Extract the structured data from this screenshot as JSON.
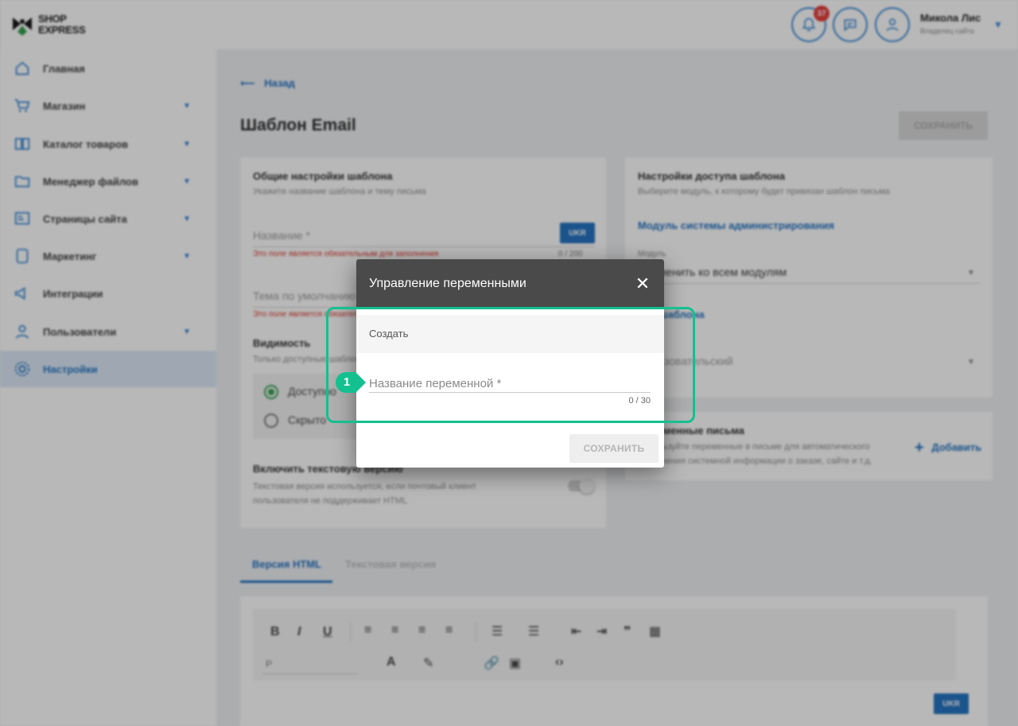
{
  "header": {
    "logo_line1": "SHOP",
    "logo_line2": "EXPRESS",
    "notification_count": "37",
    "user_name": "Микола Лис",
    "user_role": "Владелец сайта"
  },
  "sidebar": {
    "items": [
      {
        "label": "Главная",
        "icon": "home-icon"
      },
      {
        "label": "Магазин",
        "icon": "cart-icon"
      },
      {
        "label": "Каталог товаров",
        "icon": "book-icon"
      },
      {
        "label": "Менеджер файлов",
        "icon": "folder-icon"
      },
      {
        "label": "Страницы сайта",
        "icon": "page-icon"
      },
      {
        "label": "Маркетинг",
        "icon": "marketing-icon"
      },
      {
        "label": "Интеграции",
        "icon": "megaphone-icon"
      },
      {
        "label": "Пользователи",
        "icon": "user-icon"
      },
      {
        "label": "Настройки",
        "icon": "gear-icon"
      }
    ]
  },
  "page": {
    "back_label": "Назад",
    "title": "Шаблон Email",
    "save_label": "СОХРАНИТЬ"
  },
  "general_card": {
    "title": "Общие настройки шаблона",
    "subtitle": "Укажите название шаблона и тему письма",
    "name_label": "Название *",
    "lang_badge": "UKR",
    "error_text": "Это поле является обязательным для заполнения",
    "name_counter": "0 / 200",
    "subject_label": "Тема по умолчанию",
    "subject_error": "Это поле является обязательным",
    "visibility_title": "Видимость",
    "visibility_sub": "Только доступные шаблоны",
    "radio_available": "Доступно",
    "radio_hidden": "Скрыто",
    "text_version_title": "Включить текстовую версию",
    "text_version_desc1": "Текстовая версия используется, если почтовый клиент",
    "text_version_desc2": "пользователя не поддерживает HTML"
  },
  "access_card": {
    "title": "Настройки доступа шаблона",
    "subtitle": "Выберите модуль, к которому будет привязан шаблон письма",
    "module_link": "Модуль системы администрирования",
    "module_label": "Модуль",
    "module_value": "Применить ко всем модулям",
    "type_link": "Тип шаблона",
    "type_value": "Пользовательский"
  },
  "vars_card": {
    "title": "Переменные письма",
    "desc1": "Используйте переменные в письме для автоматического",
    "desc2": "заполнения системной информации о заказе, сайте и т.д.",
    "add_label": "Добавить"
  },
  "tabs": {
    "html": "Версия HTML",
    "text": "Текстовая версия"
  },
  "editor": {
    "paragraph_select": "P",
    "lang_badge": "UKR"
  },
  "modal": {
    "title": "Управление переменными",
    "section_label": "Создать",
    "input_placeholder": "Название переменной *",
    "input_value": "",
    "counter": "0 / 30",
    "save_label": "СОХРАНИТЬ"
  },
  "annotation": {
    "number": "1",
    "color": "#13c08f"
  }
}
